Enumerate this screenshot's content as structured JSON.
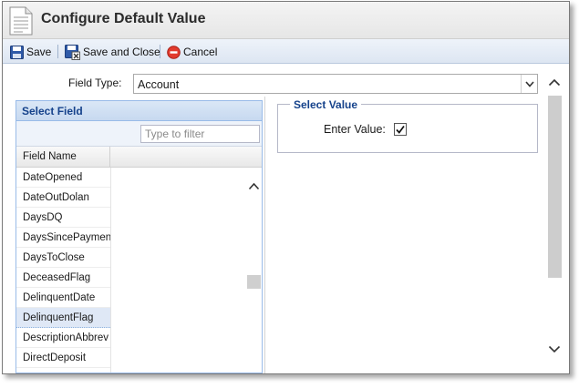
{
  "window": {
    "title": "Configure Default Value"
  },
  "toolbar": {
    "save_label": "Save",
    "save_close_label": "Save and Close",
    "cancel_label": "Cancel"
  },
  "field_type": {
    "label": "Field Type:",
    "value": "Account"
  },
  "select_field": {
    "header": "Select Field",
    "filter_placeholder": "Type to filter",
    "column_header": "Field Name",
    "rows": [
      "DateOpened",
      "DateOutDolan",
      "DaysDQ",
      "DaysSincePayment",
      "DaysToClose",
      "DeceasedFlag",
      "DelinquentDate",
      "DelinquentFlag",
      "DescriptionAbbrev",
      "DirectDeposit"
    ],
    "selected_row": "DelinquentFlag"
  },
  "select_value": {
    "legend": "Select Value",
    "enter_label": "Enter Value:",
    "enter_checked": true
  },
  "icons": {
    "title": "document-icon",
    "save": "floppy-disk-icon",
    "save_close": "floppy-disk-close-icon",
    "cancel": "cancel-circle-icon"
  },
  "colors": {
    "header_text": "#15428b",
    "panel_border": "#99bbe8",
    "selected_row": "#dfe8f6"
  }
}
